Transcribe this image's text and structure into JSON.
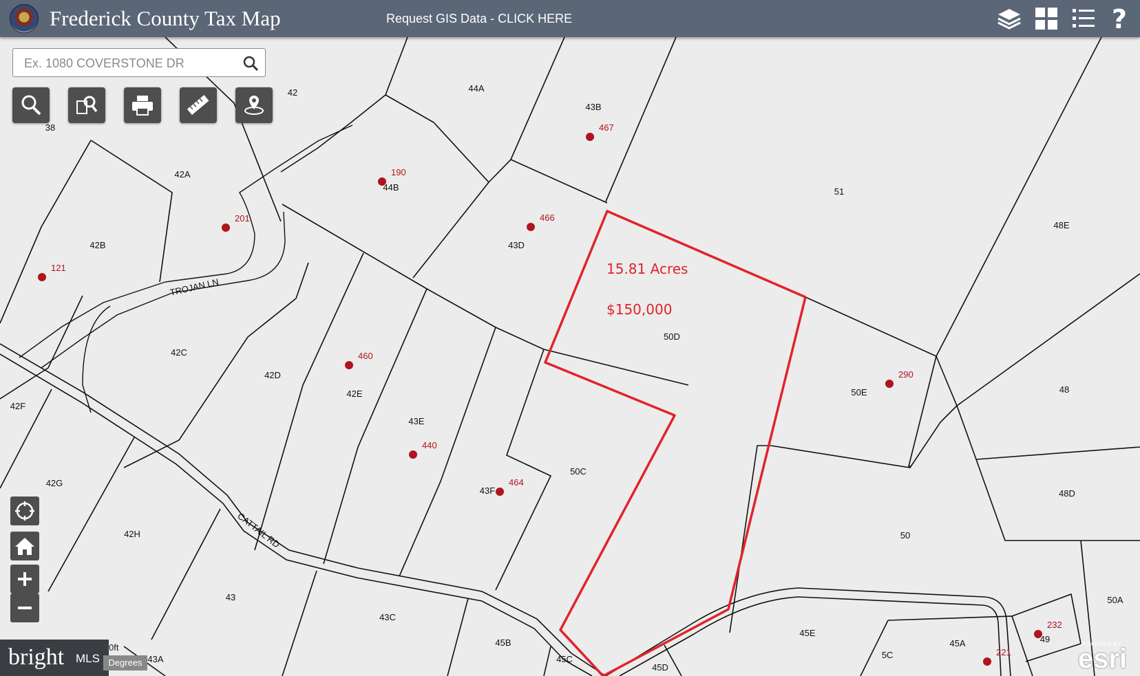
{
  "header": {
    "title": "Frederick County Tax Map",
    "gis_link": "Request GIS Data - CLICK HERE",
    "icons": [
      "layers-icon",
      "basemap-gallery-icon",
      "legend-icon",
      "help-icon"
    ]
  },
  "search": {
    "placeholder": "Ex. 1080 COVERSTONE DR",
    "value": ""
  },
  "toolbar": [
    "search-tool-icon",
    "identify-tool-icon",
    "print-tool-icon",
    "measure-tool-icon",
    "locate-address-icon"
  ],
  "nav": [
    "locate-icon",
    "home-icon",
    "zoom-in-icon",
    "zoom-out-icon"
  ],
  "highlight": {
    "acres": "15.81 Acres",
    "price": "$150,000"
  },
  "parcels": [
    {
      "id": "p44A",
      "label": "44A"
    },
    {
      "id": "p43B",
      "label": "43B"
    },
    {
      "id": "p42",
      "label": "42"
    },
    {
      "id": "p38",
      "label": "38"
    },
    {
      "id": "p42A",
      "label": "42A"
    },
    {
      "id": "p44B",
      "label": "44B"
    },
    {
      "id": "p51",
      "label": "51"
    },
    {
      "id": "p48E",
      "label": "48E"
    },
    {
      "id": "p42B",
      "label": "42B"
    },
    {
      "id": "p43D",
      "label": "43D"
    },
    {
      "id": "p50D",
      "label": "50D"
    },
    {
      "id": "p42C",
      "label": "42C"
    },
    {
      "id": "p42D",
      "label": "42D"
    },
    {
      "id": "p42E",
      "label": "42E"
    },
    {
      "id": "p50E",
      "label": "50E"
    },
    {
      "id": "p48",
      "label": "48"
    },
    {
      "id": "p42F",
      "label": "42F"
    },
    {
      "id": "p43E",
      "label": "43E"
    },
    {
      "id": "p50C",
      "label": "50C"
    },
    {
      "id": "p48D",
      "label": "48D"
    },
    {
      "id": "p42G",
      "label": "42G"
    },
    {
      "id": "p43F",
      "label": "43F"
    },
    {
      "id": "p42H",
      "label": "42H"
    },
    {
      "id": "p50",
      "label": "50"
    },
    {
      "id": "p43",
      "label": "43"
    },
    {
      "id": "p43C",
      "label": "43C"
    },
    {
      "id": "p45E",
      "label": "45E"
    },
    {
      "id": "p50A",
      "label": "50A"
    },
    {
      "id": "p45B",
      "label": "45B"
    },
    {
      "id": "p45A",
      "label": "45A"
    },
    {
      "id": "p49",
      "label": "49"
    },
    {
      "id": "p43A",
      "label": "43A"
    },
    {
      "id": "p45C",
      "label": "45C"
    },
    {
      "id": "p45D",
      "label": "45D"
    },
    {
      "id": "p5C",
      "label": "5C"
    }
  ],
  "addresses": [
    "467",
    "190",
    "201",
    "466",
    "121",
    "460",
    "290",
    "440",
    "464",
    "232",
    "221"
  ],
  "roads": [
    "TROJAN LN",
    "CATTAIL RD"
  ],
  "footer": {
    "brand": "bright",
    "brand_suffix": "MLS",
    "scale": "0ft",
    "units": "Degrees",
    "esri": "esri",
    "esri_powered": "POWERED BY"
  },
  "colors": {
    "header": "#5b6677",
    "highlight": "#e0242b",
    "address": "#b0141c",
    "map_bg": "#ececec"
  }
}
